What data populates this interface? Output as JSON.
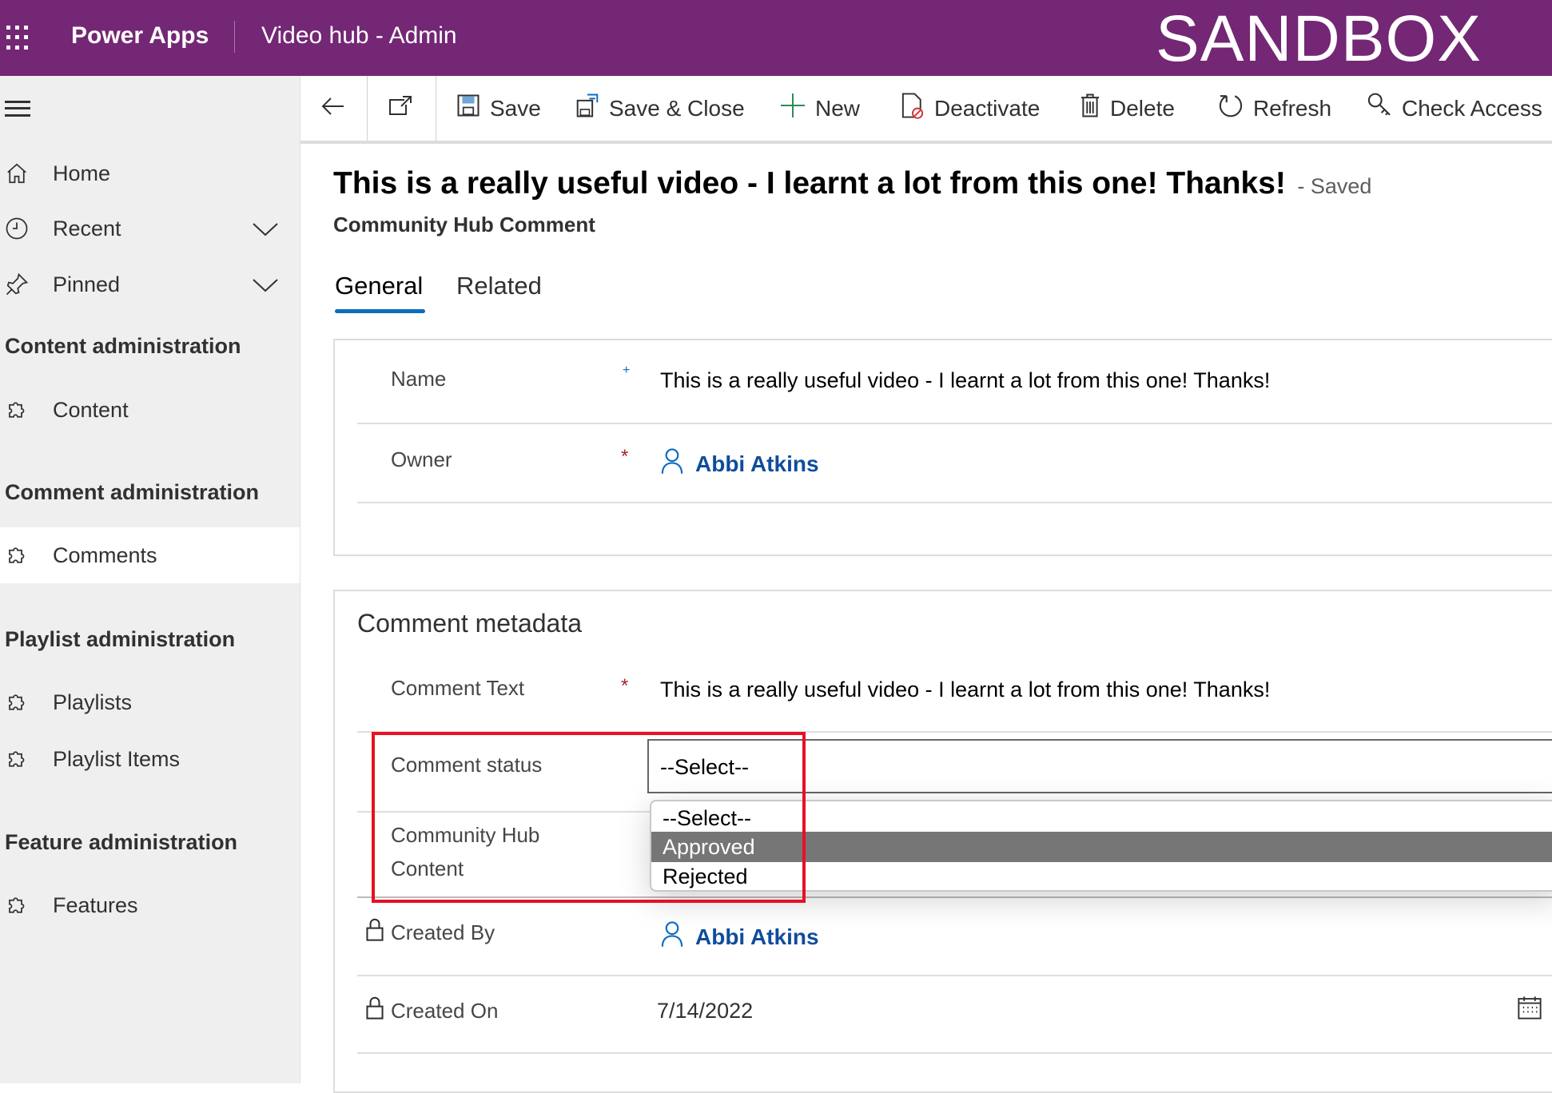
{
  "topbar": {
    "app": "Power Apps",
    "env": "Video hub - Admin",
    "badge": "SANDBOX"
  },
  "sidebar": {
    "home": "Home",
    "recent": "Recent",
    "pinned": "Pinned",
    "groups": [
      {
        "title": "Content administration",
        "items": [
          "Content"
        ]
      },
      {
        "title": "Comment administration",
        "items": [
          "Comments"
        ]
      },
      {
        "title": "Playlist administration",
        "items": [
          "Playlists",
          "Playlist Items"
        ]
      },
      {
        "title": "Feature administration",
        "items": [
          "Features"
        ]
      }
    ]
  },
  "toolbar": {
    "save": "Save",
    "save_close": "Save & Close",
    "new": "New",
    "deactivate": "Deactivate",
    "delete": "Delete",
    "refresh": "Refresh",
    "check_access": "Check Access"
  },
  "record": {
    "title": "This is a really useful video - I learnt a lot from this one! Thanks!",
    "status": "- Saved",
    "entity": "Community Hub Comment"
  },
  "tabs": [
    "General",
    "Related"
  ],
  "form": {
    "name_label": "Name",
    "name_value": "This is a really useful video - I learnt a lot from this one! Thanks!",
    "owner_label": "Owner",
    "owner_value": "Abbi Atkins",
    "section_title": "Comment metadata",
    "comment_text_label": "Comment Text",
    "comment_text_value": "This is a really useful video - I learnt a lot from this one! Thanks!",
    "status_label": "Comment status",
    "status_value": "--Select--",
    "status_options": [
      "--Select--",
      "Approved",
      "Rejected"
    ],
    "hub_content_label_1": "Community Hub",
    "hub_content_label_2": "Content",
    "created_by_label": "Created By",
    "created_by_value": "Abbi Atkins",
    "created_on_label": "Created On",
    "created_on_value": "7/14/2022"
  },
  "colors": {
    "brand": "#742774",
    "accent": "#0f6cbd",
    "highlight": "#e81123"
  }
}
